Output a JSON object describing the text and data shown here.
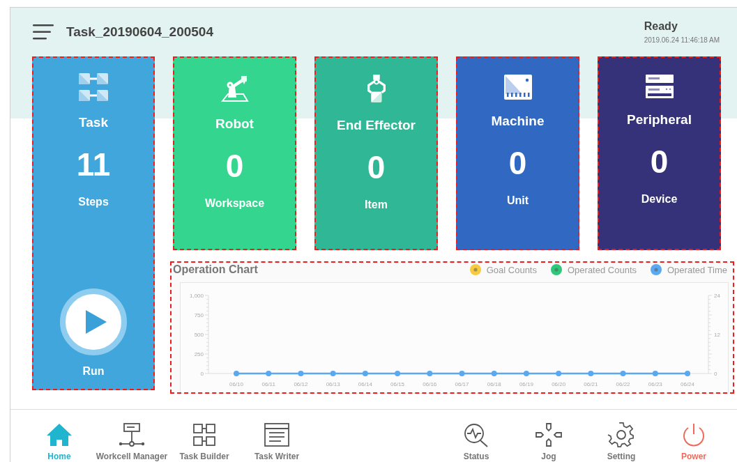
{
  "header": {
    "title": "Task_20190604_200504",
    "status": "Ready",
    "timestamp": "2019.06.24 11:46:18 AM"
  },
  "task_card": {
    "label": "Task",
    "count": "11",
    "unit": "Steps",
    "run_label": "Run",
    "color": "#40a6db",
    "highlighted": true
  },
  "cards": [
    {
      "kind": "robot",
      "label": "Robot",
      "count": "0",
      "unit": "Workspace",
      "color": "#34d68f",
      "highlighted": true
    },
    {
      "kind": "effector",
      "label": "End Effector",
      "count": "0",
      "unit": "Item",
      "color": "#30b896",
      "highlighted": true
    },
    {
      "kind": "machine",
      "label": "Machine",
      "count": "0",
      "unit": "Unit",
      "color": "#3169c2",
      "highlighted": true
    },
    {
      "kind": "peripheral",
      "label": "Peripheral",
      "count": "0",
      "unit": "Device",
      "color": "#35327a",
      "highlighted": true
    }
  ],
  "operation_chart": {
    "title": "Operation Chart",
    "highlighted": true,
    "chart_data": {
      "type": "line",
      "categories": [
        "06/10",
        "06/11",
        "06/12",
        "06/13",
        "06/14",
        "06/15",
        "06/16",
        "06/17",
        "06/18",
        "06/19",
        "06/20",
        "06/21",
        "06/22",
        "06/23",
        "06/24"
      ],
      "series": [
        {
          "name": "Goal Counts",
          "color": "#f7cb3f",
          "values": [
            null,
            null,
            null,
            null,
            null,
            null,
            null,
            null,
            null,
            null,
            null,
            null,
            null,
            null,
            null
          ]
        },
        {
          "name": "Operated Counts",
          "color": "#2dc77a",
          "values": [
            null,
            null,
            null,
            null,
            null,
            null,
            null,
            null,
            null,
            null,
            null,
            null,
            null,
            null,
            null
          ]
        },
        {
          "name": "Operated Time",
          "color": "#5aa8ef",
          "marker": "circle",
          "values": [
            0,
            0,
            0,
            0,
            0,
            0,
            0,
            0,
            0,
            0,
            0,
            0,
            0,
            0,
            0
          ]
        }
      ],
      "ylim": [
        0,
        1000
      ],
      "yticks": [
        0,
        250,
        500,
        750,
        {
          "value": 1000,
          "label": "1,000"
        }
      ],
      "y2lim": [
        0,
        24
      ],
      "y2ticks": [
        0,
        12,
        24
      ]
    }
  },
  "nav_left": [
    {
      "kind": "home",
      "label": "Home",
      "selected": true
    },
    {
      "kind": "workcell",
      "label": "Workcell Manager",
      "selected": false
    },
    {
      "kind": "builder",
      "label": "Task Builder",
      "selected": false
    },
    {
      "kind": "writer",
      "label": "Task Writer",
      "selected": false
    }
  ],
  "nav_right": [
    {
      "kind": "status",
      "label": "Status",
      "selected": false
    },
    {
      "kind": "jog",
      "label": "Jog",
      "selected": false
    },
    {
      "kind": "setting",
      "label": "Setting",
      "selected": false
    },
    {
      "kind": "power",
      "label": "Power",
      "selected": false
    }
  ]
}
